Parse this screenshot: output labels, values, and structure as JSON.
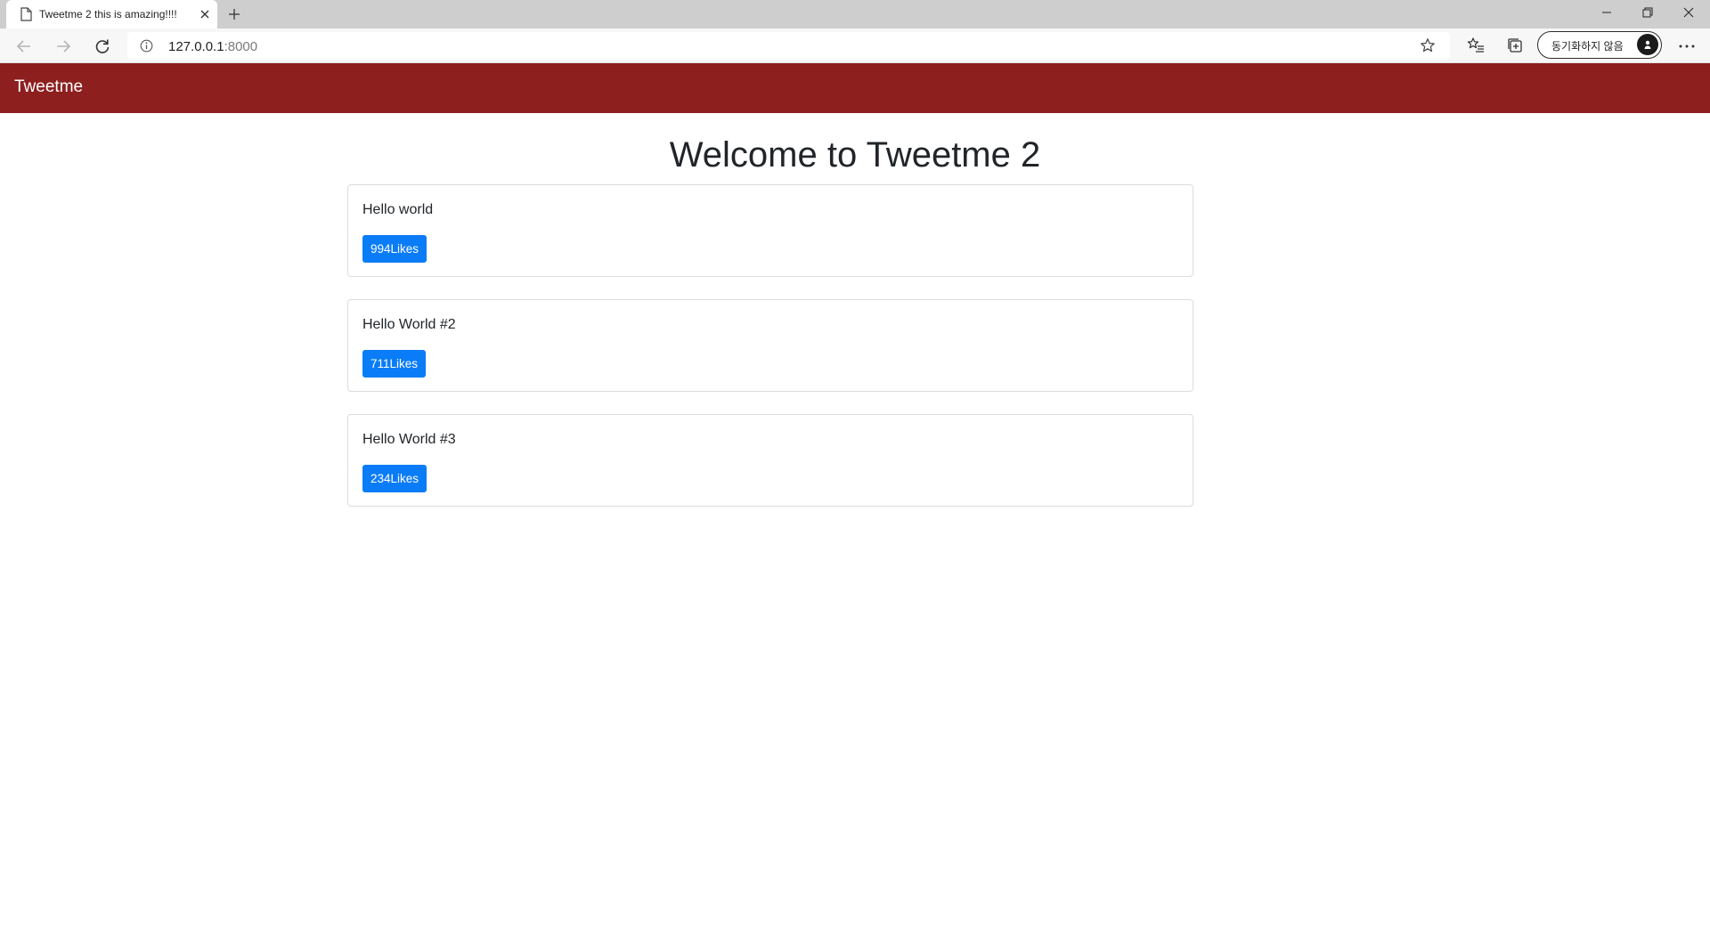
{
  "browser": {
    "tab": {
      "title": "Tweetme 2 this is amazing!!!!"
    },
    "address": {
      "host": "127.0.0.1",
      "port": ":8000"
    },
    "profile": {
      "label": "동기화하지 않음"
    }
  },
  "navbar": {
    "brand": "Tweetme"
  },
  "page": {
    "heading": "Welcome to Tweetme 2"
  },
  "tweets": [
    {
      "content": "Hello world",
      "likes_label": "994Likes"
    },
    {
      "content": "Hello World #2",
      "likes_label": "711Likes"
    },
    {
      "content": "Hello World #3",
      "likes_label": "234Likes"
    }
  ],
  "colors": {
    "navbar_bg": "#8d1f1f",
    "like_button": "#0b7cf7"
  },
  "icons": {
    "tab": "page-icon",
    "close": "close-icon",
    "new_tab": "plus-icon",
    "back": "arrow-left-icon",
    "forward": "arrow-right-icon",
    "reload": "reload-icon",
    "info": "info-icon",
    "star": "star-icon",
    "favorites": "favorites-icon",
    "collections": "collections-icon",
    "more": "more-icon"
  }
}
